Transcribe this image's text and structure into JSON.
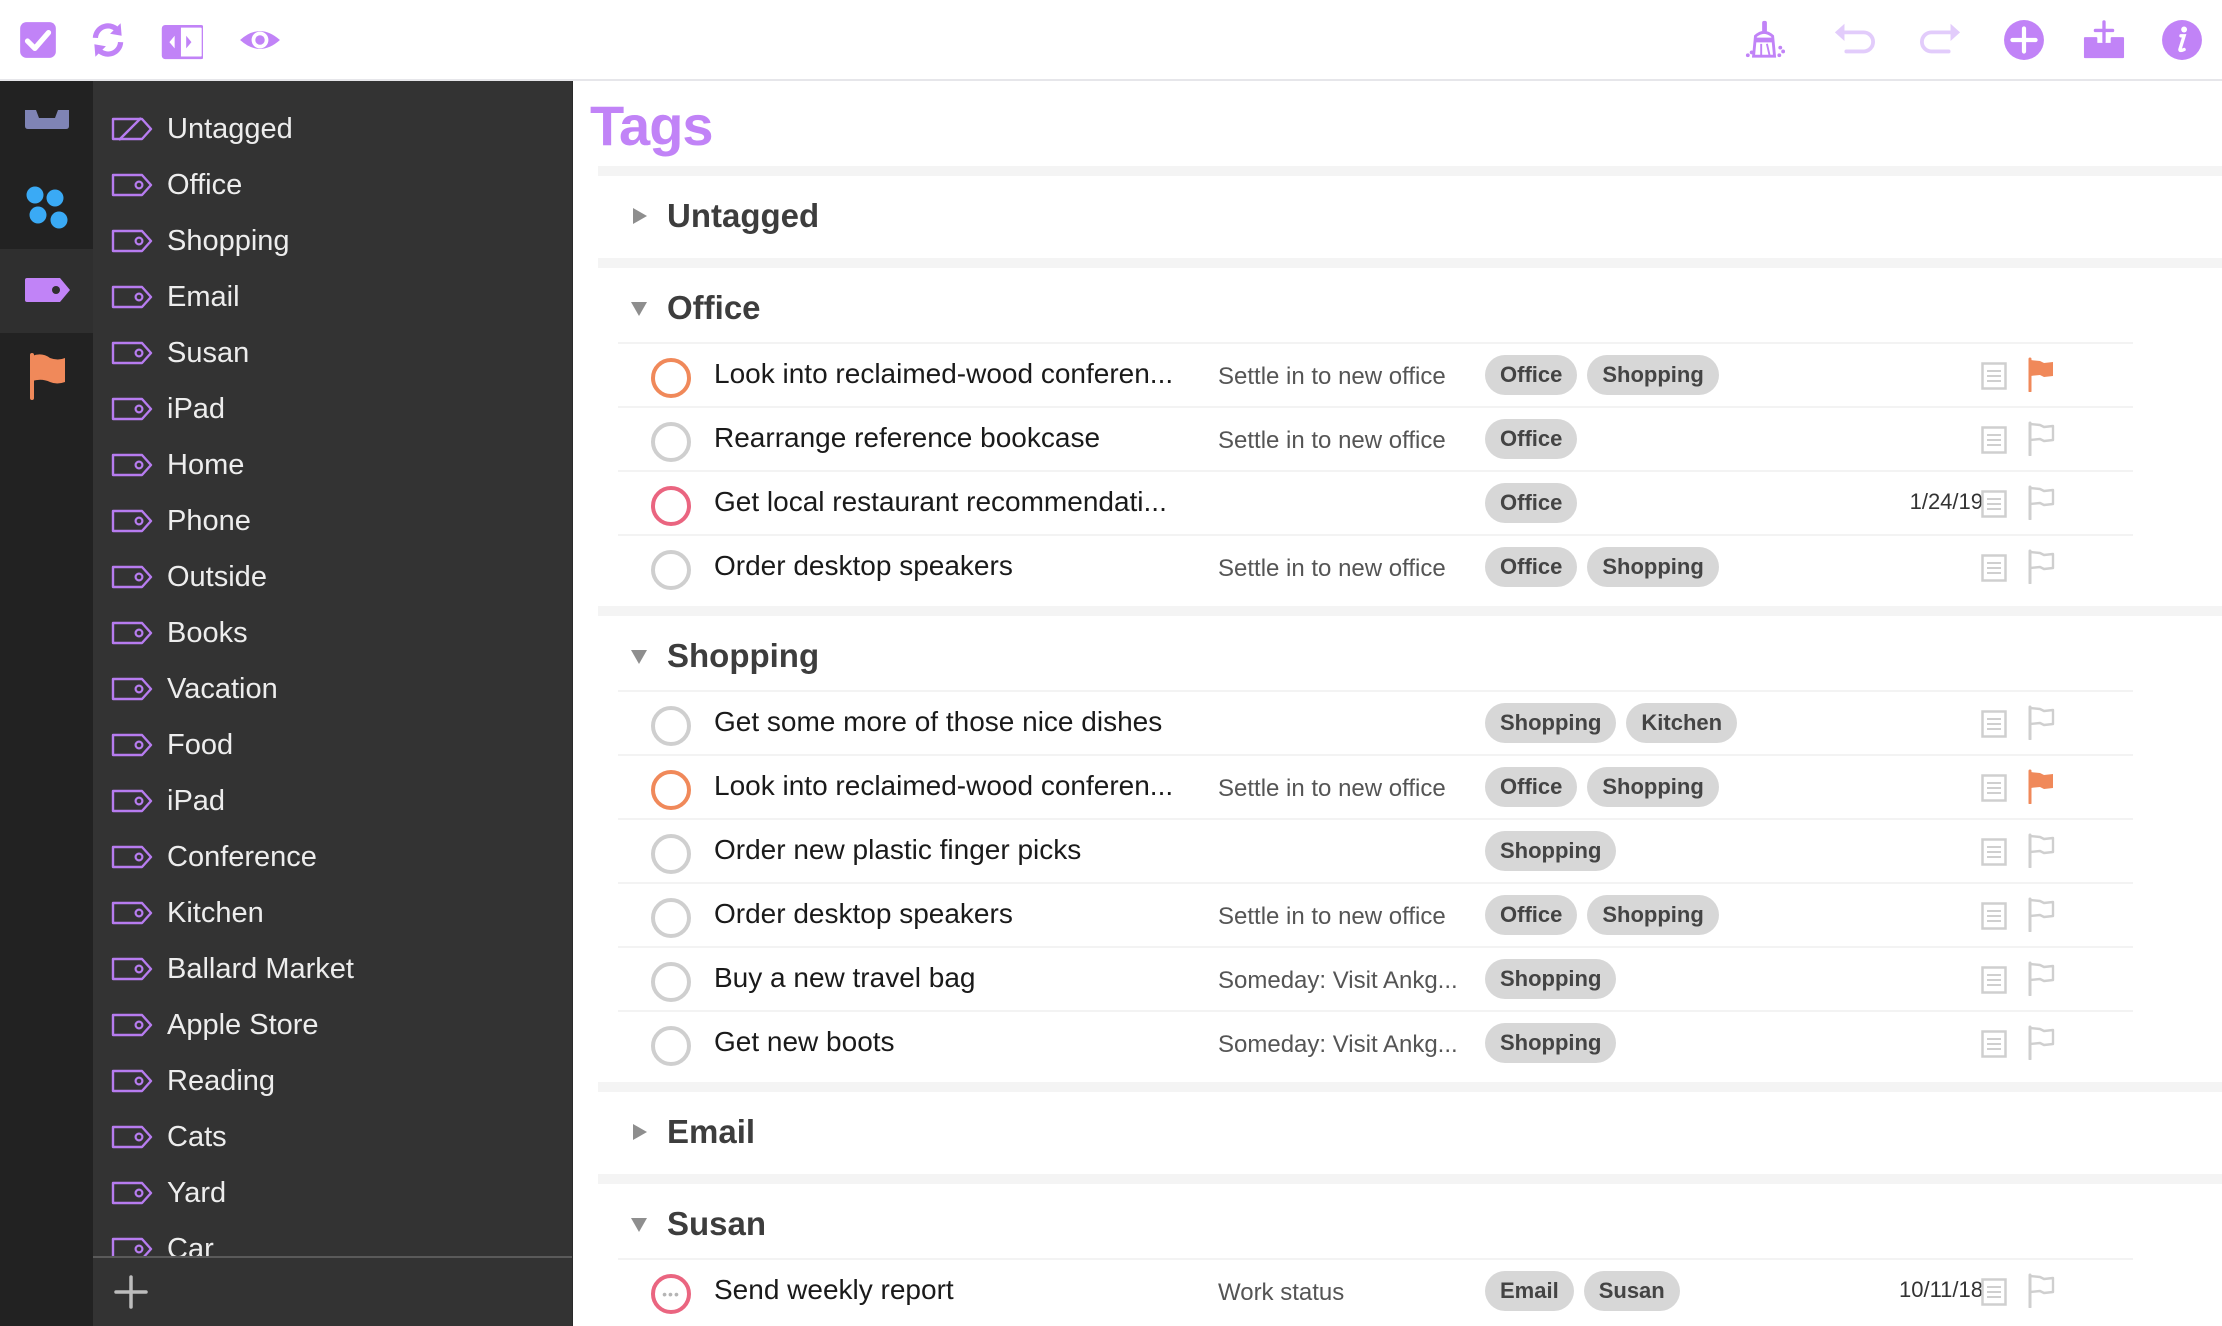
{
  "toolbar": {
    "left": [
      {
        "name": "completed-toggle-icon",
        "label": "Completed"
      },
      {
        "name": "sync-icon",
        "label": "Sync"
      },
      {
        "name": "sidebar-toggle-icon",
        "label": "Toggle Sidebar"
      },
      {
        "name": "view-options-icon",
        "label": "View Options"
      }
    ],
    "right": [
      {
        "name": "clean-up-icon",
        "label": "Clean Up"
      },
      {
        "name": "undo-icon",
        "label": "Undo"
      },
      {
        "name": "redo-icon",
        "label": "Redo"
      },
      {
        "name": "new-item-icon",
        "label": "New Item"
      },
      {
        "name": "quick-entry-icon",
        "label": "Quick Entry"
      },
      {
        "name": "inspector-icon",
        "label": "Inspector"
      }
    ],
    "accent": "#c183f7"
  },
  "rail": [
    {
      "name": "inbox",
      "icon": "inbox-icon",
      "color": "#7f84b5",
      "active": false
    },
    {
      "name": "projects",
      "icon": "projects-icon",
      "color": "#3aaaf5",
      "active": false
    },
    {
      "name": "tags",
      "icon": "tag-icon",
      "color": "#c183f7",
      "active": true
    },
    {
      "name": "flagged",
      "icon": "flag-icon",
      "color": "#f0895a",
      "active": false
    }
  ],
  "tag_list": {
    "items": [
      "Untagged",
      "Office",
      "Shopping",
      "Email",
      "Susan",
      "iPad",
      "Home",
      "Phone",
      "Outside",
      "Books",
      "Vacation",
      "Food",
      "iPad",
      "Conference",
      "Kitchen",
      "Ballard Market",
      "Apple Store",
      "Reading",
      "Cats",
      "Yard",
      "Car"
    ],
    "add_label": "Add Tag"
  },
  "main": {
    "title": "Tags",
    "groups": [
      {
        "name": "Untagged",
        "expanded": false,
        "rows": []
      },
      {
        "name": "Office",
        "expanded": true,
        "rows": [
          {
            "title": "Look into reclaimed-wood conferen...",
            "project": "Settle in to new office",
            "tags": [
              "Office",
              "Shopping"
            ],
            "due": "",
            "status": "flagged",
            "flagged": true
          },
          {
            "title": "Rearrange reference bookcase",
            "project": "Settle in to new office",
            "tags": [
              "Office"
            ],
            "due": "",
            "status": "normal",
            "flagged": false
          },
          {
            "title": "Get local restaurant recommendati...",
            "project": "",
            "tags": [
              "Office"
            ],
            "due": "1/24/19",
            "status": "due",
            "flagged": false
          },
          {
            "title": "Order desktop speakers",
            "project": "Settle in to new office",
            "tags": [
              "Office",
              "Shopping"
            ],
            "due": "",
            "status": "normal",
            "flagged": false
          }
        ]
      },
      {
        "name": "Shopping",
        "expanded": true,
        "rows": [
          {
            "title": "Get some more of those nice dishes",
            "project": "",
            "tags": [
              "Shopping",
              "Kitchen"
            ],
            "due": "",
            "status": "normal",
            "flagged": false
          },
          {
            "title": "Look into reclaimed-wood conferen...",
            "project": "Settle in to new office",
            "tags": [
              "Office",
              "Shopping"
            ],
            "due": "",
            "status": "flagged",
            "flagged": true
          },
          {
            "title": "Order new plastic finger picks",
            "project": "",
            "tags": [
              "Shopping"
            ],
            "due": "",
            "status": "normal",
            "flagged": false
          },
          {
            "title": "Order desktop speakers",
            "project": "Settle in to new office",
            "tags": [
              "Office",
              "Shopping"
            ],
            "due": "",
            "status": "normal",
            "flagged": false
          },
          {
            "title": "Buy a new travel bag",
            "project": "Someday: Visit Ankg...",
            "tags": [
              "Shopping"
            ],
            "due": "",
            "status": "normal",
            "flagged": false
          },
          {
            "title": "Get new boots",
            "project": "Someday: Visit Ankg...",
            "tags": [
              "Shopping"
            ],
            "due": "",
            "status": "normal",
            "flagged": false
          }
        ]
      },
      {
        "name": "Email",
        "expanded": false,
        "rows": []
      },
      {
        "name": "Susan",
        "expanded": true,
        "rows": [
          {
            "title": "Send weekly report",
            "project": "Work status",
            "tags": [
              "Email",
              "Susan"
            ],
            "due": "10/11/18",
            "status": "repeating-due",
            "flagged": false
          }
        ]
      }
    ]
  },
  "colors": {
    "flag": "#f0895a",
    "due": "#ea6580",
    "neutral_check": "#cfcfcf",
    "pill_bg": "#d7d7d7"
  }
}
